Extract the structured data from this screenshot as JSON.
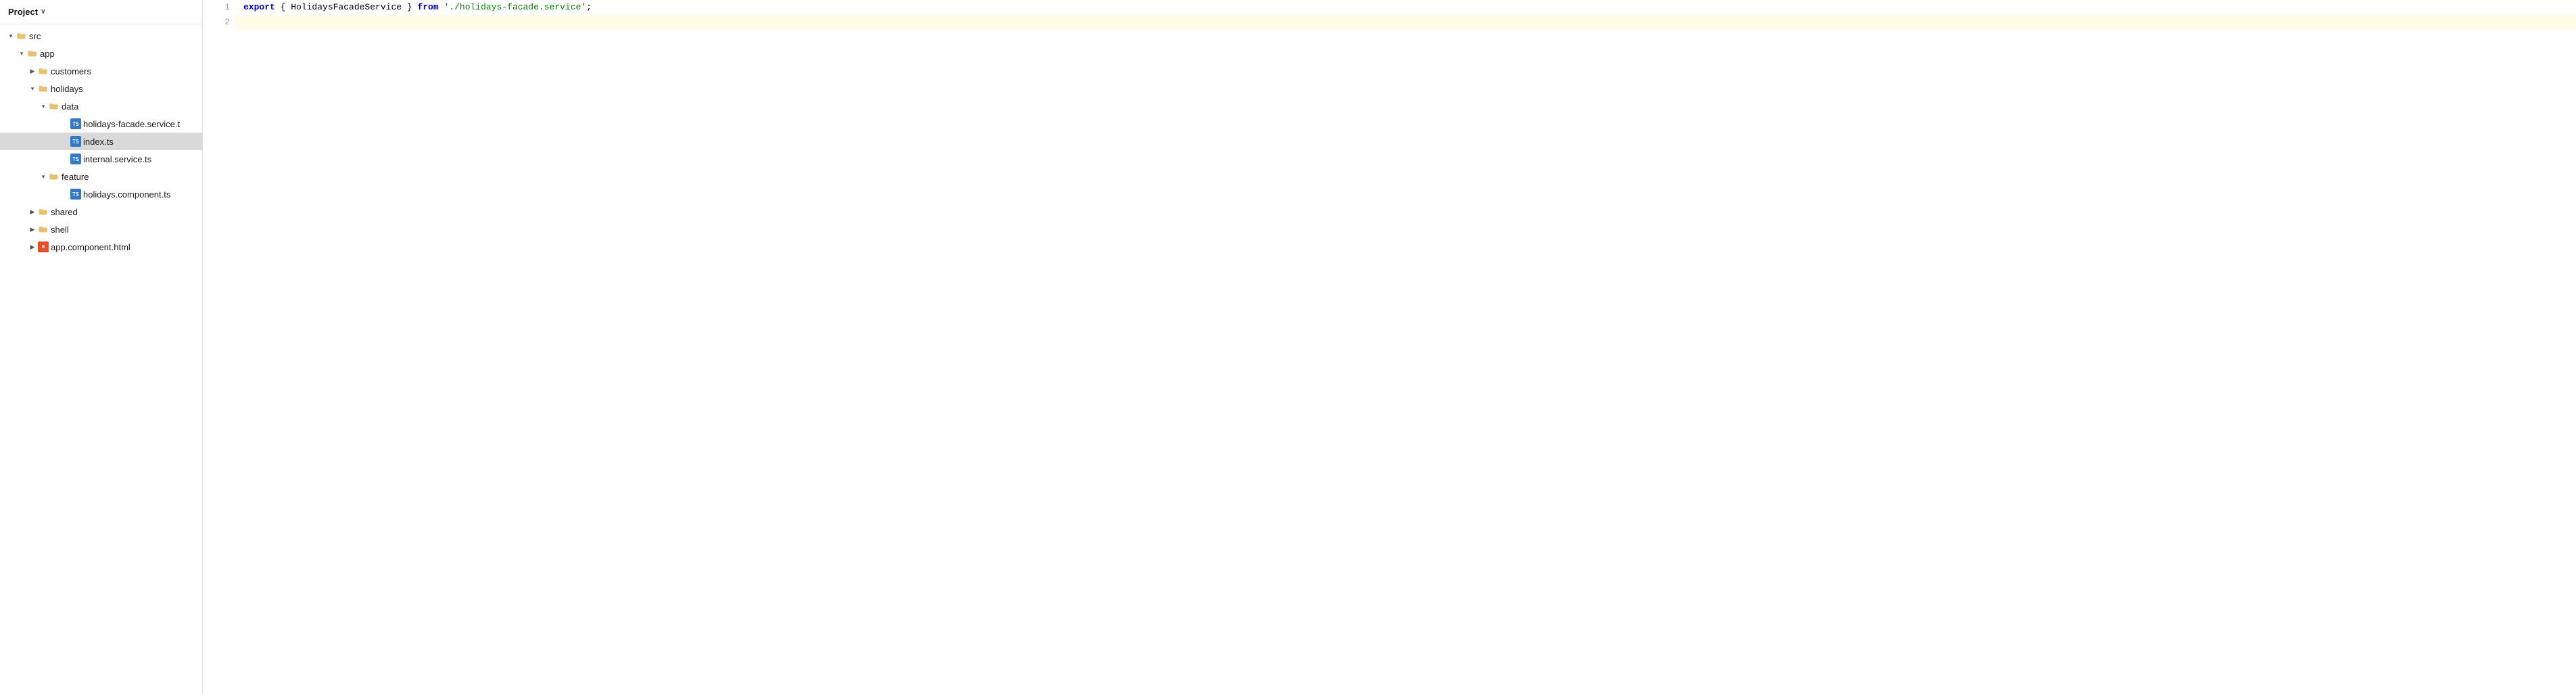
{
  "sidebar": {
    "header": {
      "title": "Project",
      "chevron": "∨"
    },
    "tree": [
      {
        "id": "src",
        "level": 0,
        "type": "folder",
        "state": "expanded",
        "label": "src"
      },
      {
        "id": "app",
        "level": 1,
        "type": "folder",
        "state": "expanded",
        "label": "app"
      },
      {
        "id": "customers",
        "level": 2,
        "type": "folder",
        "state": "collapsed",
        "label": "customers"
      },
      {
        "id": "holidays",
        "level": 2,
        "type": "folder",
        "state": "expanded",
        "label": "holidays"
      },
      {
        "id": "data",
        "level": 3,
        "type": "folder",
        "state": "expanded",
        "label": "data"
      },
      {
        "id": "holidays-facade.service.t",
        "level": 4,
        "type": "ts",
        "label": "holidays-facade.service.t"
      },
      {
        "id": "index.ts",
        "level": 4,
        "type": "ts",
        "label": "index.ts",
        "selected": true
      },
      {
        "id": "internal.service.ts",
        "level": 4,
        "type": "ts",
        "label": "internal.service.ts"
      },
      {
        "id": "feature",
        "level": 3,
        "type": "folder",
        "state": "expanded",
        "label": "feature"
      },
      {
        "id": "holidays.component.ts",
        "level": 4,
        "type": "ts",
        "label": "holidays.component.ts"
      },
      {
        "id": "shared",
        "level": 2,
        "type": "folder",
        "state": "collapsed",
        "label": "shared"
      },
      {
        "id": "shell",
        "level": 2,
        "type": "folder",
        "state": "collapsed",
        "label": "shell"
      },
      {
        "id": "app.component.html",
        "level": 2,
        "type": "html_partial",
        "label": "app.component.html"
      }
    ]
  },
  "editor": {
    "lines": [
      {
        "number": 1,
        "highlighted": false,
        "parts": [
          {
            "type": "kw",
            "text": "export"
          },
          {
            "type": "text",
            "text": " { HolidaysFacadeService } "
          },
          {
            "type": "kw",
            "text": "from"
          },
          {
            "type": "text",
            "text": " "
          },
          {
            "type": "str",
            "text": "'./holidays-facade.service'"
          },
          {
            "type": "text",
            "text": ";"
          }
        ]
      },
      {
        "number": 2,
        "highlighted": true,
        "parts": []
      }
    ]
  }
}
